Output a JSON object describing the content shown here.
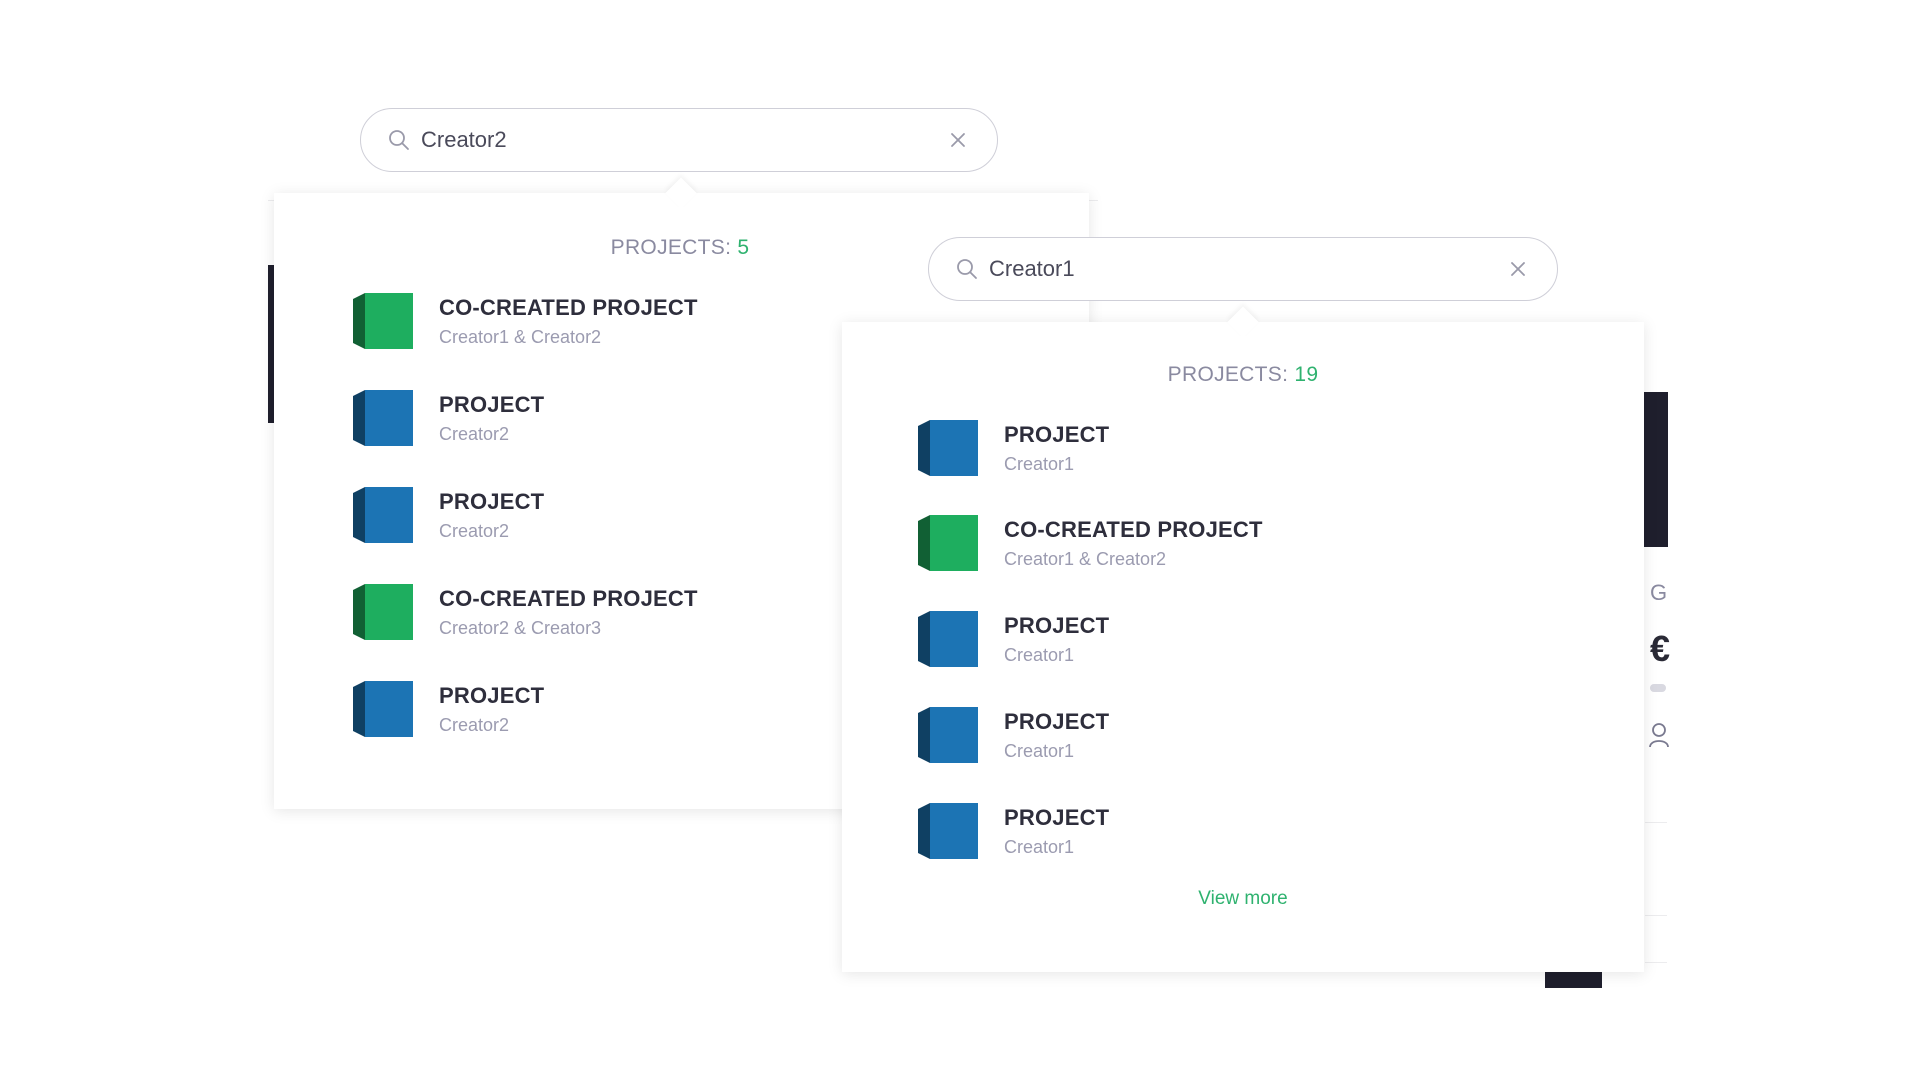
{
  "search_left": {
    "query": "Creator2",
    "count_label": "PROJECTS: ",
    "count": "5",
    "items": [
      {
        "title": "CO-CREATED PROJECT",
        "creator": "Creator1 & Creator2",
        "cube_color": "green"
      },
      {
        "title": "PROJECT",
        "creator": "Creator2",
        "cube_color": "blue"
      },
      {
        "title": "PROJECT",
        "creator": "Creator2",
        "cube_color": "blue"
      },
      {
        "title": "CO-CREATED PROJECT",
        "creator": "Creator2 & Creator3",
        "cube_color": "green"
      },
      {
        "title": "PROJECT",
        "creator": "Creator2",
        "cube_color": "blue"
      }
    ]
  },
  "search_right": {
    "query": "Creator1",
    "count_label": "PROJECTS: ",
    "count": "19",
    "items": [
      {
        "title": "PROJECT",
        "creator": "Creator1",
        "cube_color": "blue"
      },
      {
        "title": "CO-CREATED PROJECT",
        "creator": "Creator1 & Creator2",
        "cube_color": "green"
      },
      {
        "title": "PROJECT",
        "creator": "Creator1",
        "cube_color": "blue"
      },
      {
        "title": "PROJECT",
        "creator": "Creator1",
        "cube_color": "blue"
      },
      {
        "title": "PROJECT",
        "creator": "Creator1",
        "cube_color": "blue"
      }
    ],
    "view_more": "View more"
  },
  "background": {
    "partial_letter": "G",
    "partial_currency": "€"
  },
  "colors": {
    "accent_green": "#2fb26f",
    "cube_green": "#1eae5f",
    "cube_blue": "#1c74b4",
    "dark": "#1f1f2d"
  },
  "icons": {
    "search": "search-icon",
    "clear": "close-icon",
    "cube": "cube-icon"
  }
}
